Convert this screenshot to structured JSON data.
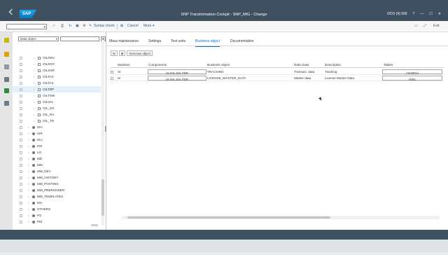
{
  "window": {
    "title": "SNP Transformation Cockpit - SNP_MIG - Change",
    "system": "DCO (4) 000",
    "brand": "SAP",
    "accent": "#0a6ed1",
    "header_color": "#3f5161"
  },
  "toolbar": {
    "syntax_check": "Syntax check",
    "cancel": "Cancel",
    "more": "More",
    "exit": "Exit"
  },
  "left": {
    "object_select": "Data object",
    "tree": [
      {
        "label": "OILREV",
        "level": 2,
        "type": "doc"
      },
      {
        "label": "OILROY",
        "level": 2,
        "type": "doc"
      },
      {
        "label": "OILSSR",
        "level": 2,
        "type": "doc"
      },
      {
        "label": "OILTAS",
        "level": 2,
        "type": "doc"
      },
      {
        "label": "OILTAX",
        "level": 2,
        "type": "doc"
      },
      {
        "label": "OILTDP",
        "level": 2,
        "type": "doc",
        "selected": true
      },
      {
        "label": "OILTSW",
        "level": 2,
        "type": "doc"
      },
      {
        "label": "OILVAL",
        "level": 2,
        "type": "doc"
      },
      {
        "label": "OIL_DS",
        "level": 2,
        "type": "doc"
      },
      {
        "label": "OIL_RV",
        "level": 2,
        "type": "doc"
      },
      {
        "label": "OIL_TD",
        "level": 2,
        "type": "doc"
      },
      {
        "label": "ISH",
        "level": 1,
        "type": "ball"
      },
      {
        "label": "ISR",
        "level": 1,
        "type": "ball"
      },
      {
        "label": "ISU",
        "level": 1,
        "type": "ball"
      },
      {
        "label": "KM",
        "level": 1,
        "type": "ball"
      },
      {
        "label": "LO",
        "level": 1,
        "type": "ball"
      },
      {
        "label": "MD",
        "level": 1,
        "type": "ball"
      },
      {
        "label": "MM",
        "level": 1,
        "type": "ball"
      },
      {
        "label": "MM_DEV",
        "level": 1,
        "type": "ball"
      },
      {
        "label": "MM_HISTORY",
        "level": 1,
        "type": "ball"
      },
      {
        "label": "MM_POSTING",
        "level": 1,
        "type": "ball"
      },
      {
        "label": "MM_PRERUNNER",
        "level": 1,
        "type": "ball"
      },
      {
        "label": "MM_TEMPLATES",
        "level": 1,
        "type": "ball"
      },
      {
        "label": "MX",
        "level": 1,
        "type": "ball"
      },
      {
        "label": "OTHERS",
        "level": 1,
        "type": "ball"
      },
      {
        "label": "PS",
        "level": 1,
        "type": "ball"
      },
      {
        "label": "PM",
        "level": 1,
        "type": "ball"
      }
    ]
  },
  "tabs": [
    "Mass maintenance",
    "Settings",
    "Test units",
    "Business object",
    "Documentation"
  ],
  "grid": {
    "generate": "Generate object",
    "headers": [
      "Modules",
      "Components",
      "Business object",
      "Data class",
      "Description",
      "Tables"
    ],
    "rows": [
      [
        "IS",
        "IS-OIL-DS-TDP",
        "TRACKING",
        "Transact. data",
        "Tracking",
        "OIVBDH"
      ],
      [
        "IS",
        "IS-OIL-DS-TDP",
        "LICENSE_MASTER_DATA",
        "Master data",
        "License Master Data",
        "OIRL"
      ]
    ]
  }
}
